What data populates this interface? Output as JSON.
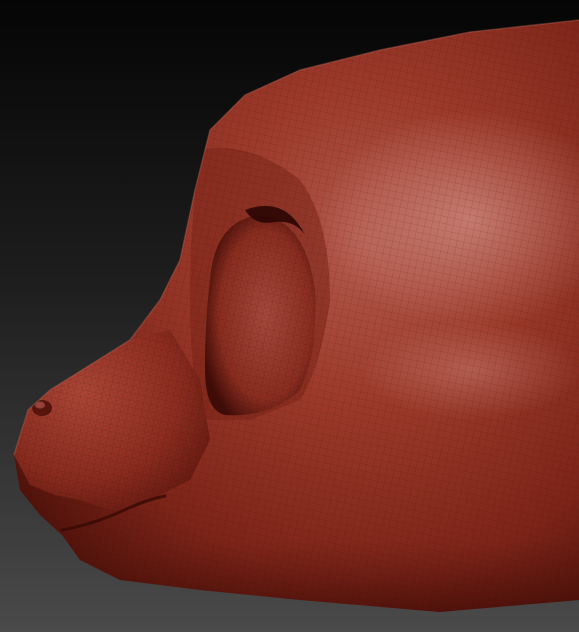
{
  "scene": {
    "subject": "sculpt-render",
    "colors": {
      "background_top": "#050505",
      "background_bottom": "#4a4a4a",
      "clay_base": "#8a2a1e",
      "clay_mid": "#a13b2b",
      "clay_light": "#c97a6e",
      "clay_shadow": "#4a0f0a",
      "wire": "#3a0a06"
    },
    "wireframe_visible": true
  }
}
